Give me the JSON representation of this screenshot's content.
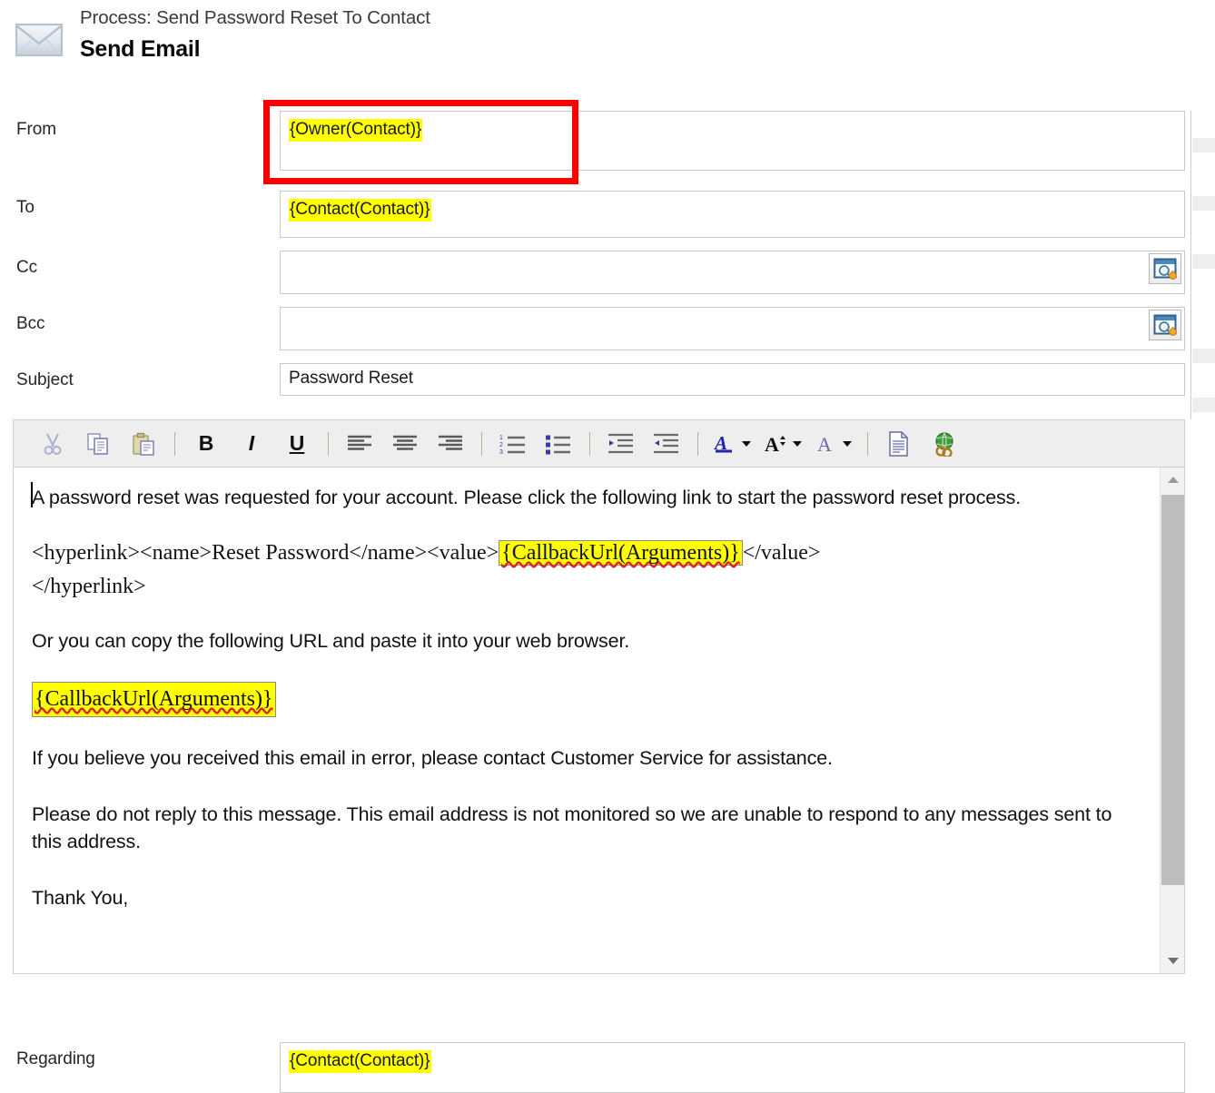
{
  "header": {
    "icon": "envelope-icon",
    "process_label": "Process: Send Password Reset To Contact",
    "title": "Send Email"
  },
  "fields": [
    {
      "label": "From",
      "value": "{Owner(Contact)}",
      "highlighted": true,
      "lookup": false
    },
    {
      "label": "To",
      "value": "{Contact(Contact)}",
      "highlighted": true,
      "lookup": false
    },
    {
      "label": "Cc",
      "value": "",
      "highlighted": false,
      "lookup": true
    },
    {
      "label": "Bcc",
      "value": "",
      "highlighted": false,
      "lookup": true
    },
    {
      "label": "Subject",
      "value": "Password Reset",
      "highlighted": false,
      "lookup": false
    },
    {
      "label": "Regarding",
      "value": "{Contact(Contact)}",
      "highlighted": true,
      "lookup": false
    }
  ],
  "toolbar": {
    "buttons": [
      {
        "name": "cut-icon",
        "label": ""
      },
      {
        "name": "copy-icon",
        "label": ""
      },
      {
        "name": "paste-icon",
        "label": ""
      },
      {
        "name": "bold-button",
        "label": "B"
      },
      {
        "name": "italic-button",
        "label": "I"
      },
      {
        "name": "underline-button",
        "label": "U"
      },
      {
        "name": "align-left-icon",
        "label": ""
      },
      {
        "name": "align-center-icon",
        "label": ""
      },
      {
        "name": "align-right-icon",
        "label": ""
      },
      {
        "name": "numbered-list-icon",
        "label": ""
      },
      {
        "name": "bulleted-list-icon",
        "label": ""
      },
      {
        "name": "increase-indent-icon",
        "label": ""
      },
      {
        "name": "decrease-indent-icon",
        "label": ""
      },
      {
        "name": "font-color-icon",
        "label": "A"
      },
      {
        "name": "font-size-icon",
        "label": "A"
      },
      {
        "name": "font-name-icon",
        "label": "A"
      },
      {
        "name": "insert-template-icon",
        "label": ""
      },
      {
        "name": "insert-hyperlink-icon",
        "label": ""
      }
    ]
  },
  "body": {
    "paragraph_1": "A password reset was requested for your account. Please click the following link to start the password reset process.",
    "hyperlink_line": {
      "before": "<hyperlink><name>Reset Password</name><value>",
      "token": "{CallbackUrl(Arguments)}",
      "after": "</value>",
      "closing": "</hyperlink>"
    },
    "paragraph_2": "Or you can copy the following URL and paste it into your web browser.",
    "url_token": "{CallbackUrl(Arguments)}",
    "paragraph_3": "If you believe you received this email in error, please contact Customer Service for assistance.",
    "paragraph_4": "Please do not reply to this message. This email address is not monitored so we are unable to respond to any messages sent to this address.",
    "paragraph_5": "Thank You,"
  },
  "scrollbar": {
    "up_arrow": "scroll-up-arrow",
    "down_arrow": "scroll-down-arrow"
  },
  "colors": {
    "highlight": "#ffff00",
    "annotation": "#fe0000",
    "toolbar_bg": "#eeeeee",
    "field_border": "#c8c8c8"
  }
}
